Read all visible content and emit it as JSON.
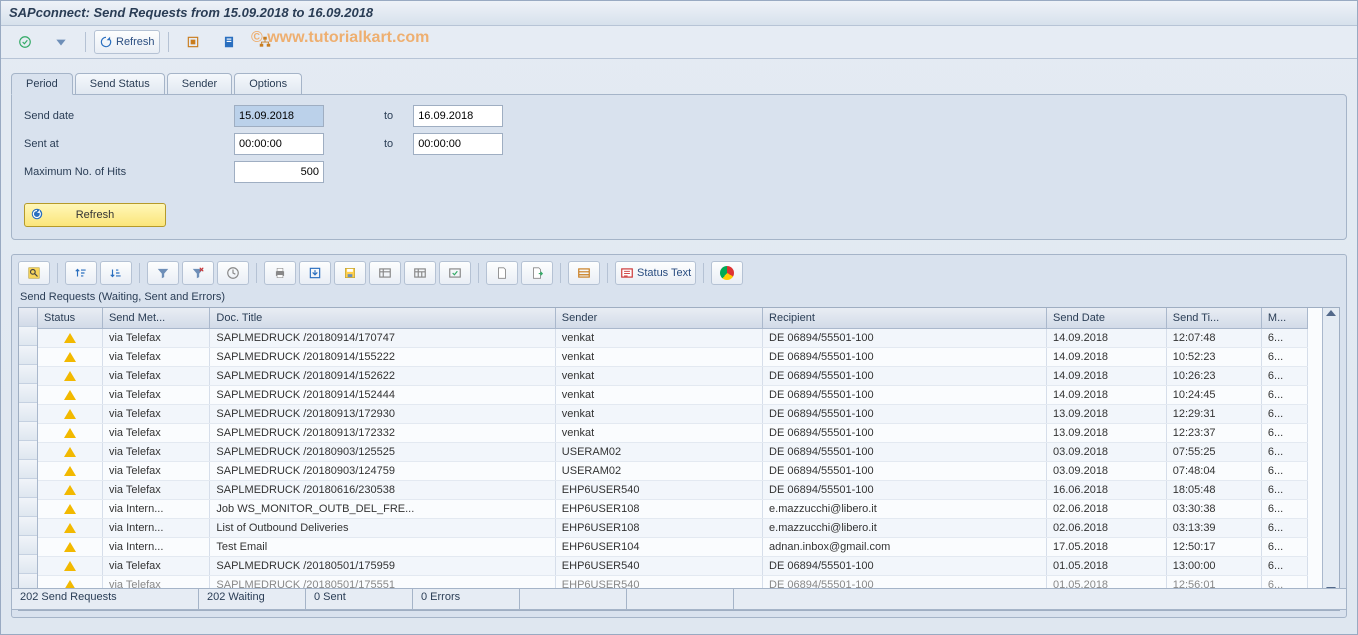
{
  "title": "SAPconnect: Send Requests from 15.09.2018 to 16.09.2018",
  "watermark": "©   www.tutorialkart.com",
  "app_toolbar": {
    "refresh_label": "Refresh"
  },
  "tabs": [
    {
      "id": "period",
      "label": "Period",
      "active": true
    },
    {
      "id": "send_status",
      "label": "Send Status",
      "active": false
    },
    {
      "id": "sender",
      "label": "Sender",
      "active": false
    },
    {
      "id": "options",
      "label": "Options",
      "active": false
    }
  ],
  "period": {
    "send_date_label": "Send date",
    "send_date_from": "15.09.2018",
    "to_label": "to",
    "send_date_to": "16.09.2018",
    "sent_at_label": "Sent at",
    "sent_at_from": "00:00:00",
    "sent_at_to": "00:00:00",
    "max_hits_label": "Maximum No. of Hits",
    "max_hits": "500",
    "refresh_btn": "Refresh"
  },
  "alv": {
    "status_text_label": "Status Text",
    "caption": "Send Requests (Waiting, Sent and Errors)",
    "columns": {
      "status": "Status",
      "method": "Send Met...",
      "title": "Doc. Title",
      "sender": "Sender",
      "recipient": "Recipient",
      "send_date": "Send Date",
      "send_time": "Send Ti...",
      "msg": "M..."
    },
    "rows": [
      {
        "method": "via Telefax",
        "title": "SAPLMEDRUCK /20180914/170747",
        "sender": "venkat",
        "recipient": "DE 06894/55501-100",
        "date": "14.09.2018",
        "time": "12:07:48",
        "msg": "6..."
      },
      {
        "method": "via Telefax",
        "title": "SAPLMEDRUCK /20180914/155222",
        "sender": "venkat",
        "recipient": "DE 06894/55501-100",
        "date": "14.09.2018",
        "time": "10:52:23",
        "msg": "6..."
      },
      {
        "method": "via Telefax",
        "title": "SAPLMEDRUCK /20180914/152622",
        "sender": "venkat",
        "recipient": "DE 06894/55501-100",
        "date": "14.09.2018",
        "time": "10:26:23",
        "msg": "6..."
      },
      {
        "method": "via Telefax",
        "title": "SAPLMEDRUCK /20180914/152444",
        "sender": "venkat",
        "recipient": "DE 06894/55501-100",
        "date": "14.09.2018",
        "time": "10:24:45",
        "msg": "6..."
      },
      {
        "method": "via Telefax",
        "title": "SAPLMEDRUCK /20180913/172930",
        "sender": "venkat",
        "recipient": "DE 06894/55501-100",
        "date": "13.09.2018",
        "time": "12:29:31",
        "msg": "6..."
      },
      {
        "method": "via Telefax",
        "title": "SAPLMEDRUCK /20180913/172332",
        "sender": "venkat",
        "recipient": "DE 06894/55501-100",
        "date": "13.09.2018",
        "time": "12:23:37",
        "msg": "6..."
      },
      {
        "method": "via Telefax",
        "title": "SAPLMEDRUCK /20180903/125525",
        "sender": "USERAM02",
        "recipient": "DE 06894/55501-100",
        "date": "03.09.2018",
        "time": "07:55:25",
        "msg": "6..."
      },
      {
        "method": "via Telefax",
        "title": "SAPLMEDRUCK /20180903/124759",
        "sender": "USERAM02",
        "recipient": "DE 06894/55501-100",
        "date": "03.09.2018",
        "time": "07:48:04",
        "msg": "6..."
      },
      {
        "method": "via Telefax",
        "title": "SAPLMEDRUCK /20180616/230538",
        "sender": "EHP6USER540",
        "recipient": "DE 06894/55501-100",
        "date": "16.06.2018",
        "time": "18:05:48",
        "msg": "6..."
      },
      {
        "method": "via Intern...",
        "title": "Job WS_MONITOR_OUTB_DEL_FRE...",
        "sender": "EHP6USER108",
        "recipient": "e.mazzucchi@libero.it",
        "date": "02.06.2018",
        "time": "03:30:38",
        "msg": "6..."
      },
      {
        "method": "via Intern...",
        "title": "List of Outbound Deliveries",
        "sender": "EHP6USER108",
        "recipient": "e.mazzucchi@libero.it",
        "date": "02.06.2018",
        "time": "03:13:39",
        "msg": "6..."
      },
      {
        "method": "via Intern...",
        "title": "Test Email",
        "sender": "EHP6USER104",
        "recipient": "adnan.inbox@gmail.com",
        "date": "17.05.2018",
        "time": "12:50:17",
        "msg": "6..."
      },
      {
        "method": "via Telefax",
        "title": "SAPLMEDRUCK /20180501/175959",
        "sender": "EHP6USER540",
        "recipient": "DE 06894/55501-100",
        "date": "01.05.2018",
        "time": "13:00:00",
        "msg": "6..."
      },
      {
        "method": "via Telefax",
        "title": "SAPLMEDRUCK /20180501/175551",
        "sender": "EHP6USER540",
        "recipient": "DE 06894/55501-100",
        "date": "01.05.2018",
        "time": "12:56:01",
        "msg": "6...",
        "cut": true
      }
    ]
  },
  "status_bar": {
    "seg1": "202 Send Requests",
    "seg2": "202 Waiting",
    "seg3": "0 Sent",
    "seg4": "0 Errors"
  }
}
